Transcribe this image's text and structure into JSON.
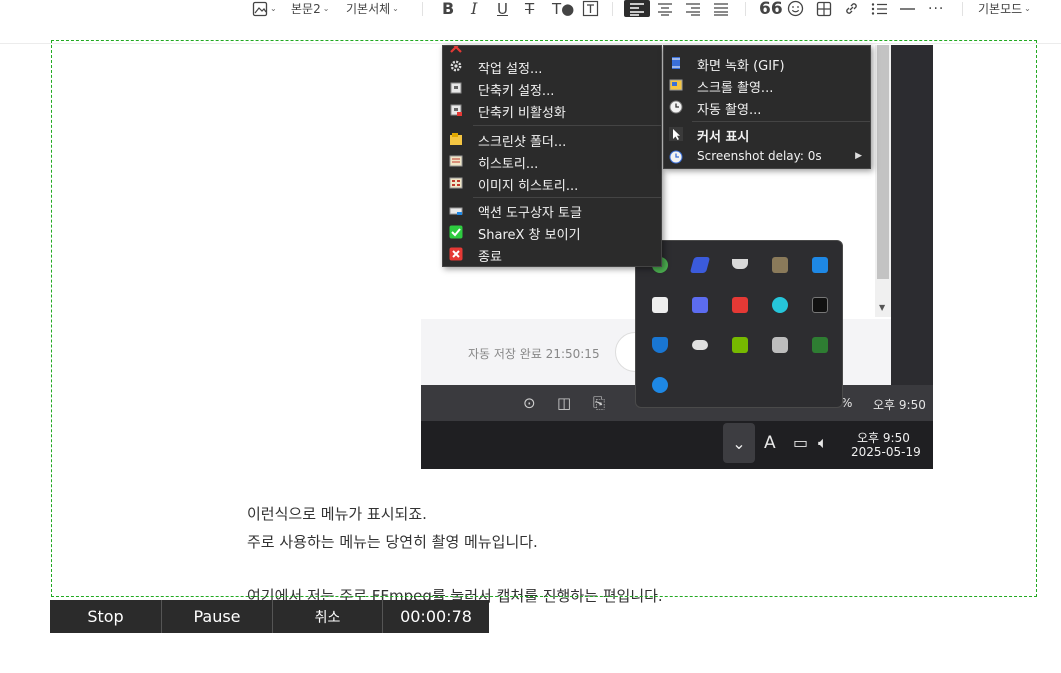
{
  "toolbar": {
    "paragraph_style": "본문2",
    "font_name": "기본서체",
    "mode": "기본모드"
  },
  "menu": {
    "items": [
      {
        "label": "작업 설정...",
        "icon": "gear-icon"
      },
      {
        "label": "단축키 설정...",
        "icon": "keyboard-icon"
      },
      {
        "label": "단축키 비활성화",
        "icon": "keyboard-disabled-icon"
      },
      {
        "label": "스크린샷 폴더...",
        "icon": "folder-icon"
      },
      {
        "label": "히스토리...",
        "icon": "history-icon"
      },
      {
        "label": "이미지 히스토리...",
        "icon": "image-history-icon"
      },
      {
        "label": "액션 도구상자 토글",
        "icon": "toolbox-icon"
      },
      {
        "label": "ShareX 창 보이기",
        "icon": "checkmark-icon"
      },
      {
        "label": "종료",
        "icon": "exit-icon"
      }
    ]
  },
  "submenu": {
    "items": [
      {
        "label": "화면 녹화 (GIF)",
        "icon": "film-icon"
      },
      {
        "label": "스크롤 촬영...",
        "icon": "scroll-capture-icon"
      },
      {
        "label": "자동 촬영...",
        "icon": "clock-icon"
      },
      {
        "label": "커서 표시",
        "icon": "cursor-icon"
      },
      {
        "label": "Screenshot delay: 0s",
        "icon": "timer-icon"
      }
    ]
  },
  "screenshot": {
    "autosave": "자동 저장 완료 21:50:15",
    "bar_percent": "%",
    "bar_time": "오후 9:50",
    "taskbar_time": "오후 9:50",
    "taskbar_date": "2025-05-19",
    "ime_label": "A"
  },
  "body_text": {
    "line1": "이런식으로 메뉴가 표시되죠.",
    "line2": "주로 사용하는 메뉴는 당연히 촬영 메뉴입니다.",
    "line3": "여기에서 저는 주로 FFmpeg를 눌러서 캡처를 진행하는 편입니다."
  },
  "recorder": {
    "stop": "Stop",
    "pause": "Pause",
    "cancel": "취소",
    "timer": "00:00:78"
  },
  "colors": {
    "selection_border": "#22aa22",
    "menu_bg": "#2b2b2b",
    "recorder_bg": "#2b2b2b",
    "taskbar_bg": "#1f1f22"
  }
}
